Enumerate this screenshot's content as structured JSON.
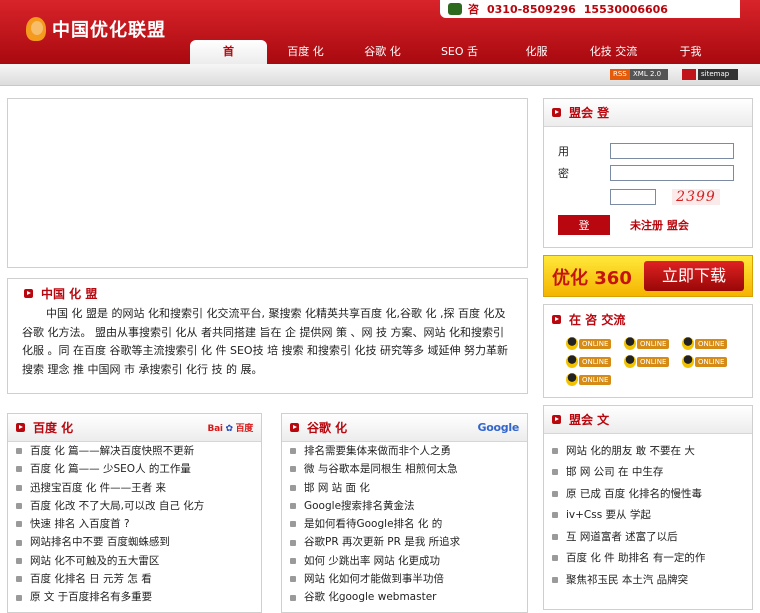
{
  "header": {
    "logo_text": "中国优化联盟",
    "phone_label": "咨",
    "phone1": "0310-8509296",
    "phone2": "15530006606"
  },
  "nav": [
    {
      "label": "首"
    },
    {
      "label": "百度 化"
    },
    {
      "label": "谷歌 化"
    },
    {
      "label": "SEO  舌"
    },
    {
      "label": "化服"
    },
    {
      "label": "化技 交流"
    },
    {
      "label": "于我"
    }
  ],
  "subbar": {
    "rss": "RSS",
    "xml": "XML 2.0",
    "sitemap": "sitemap"
  },
  "intro": {
    "title": "中国 化 盟",
    "text": "中国 化 盟是  的网站 化和搜索引  化交流平台, 聚搜索 化精英共享百度     化,谷歌 化  ,探 百度 化及谷歌 化方法。 盟由从事搜索引  化从 者共同搭建 旨在 企 提供网    策 、网    技 方案、网站 化和搜索引  化服 。同 在百度 谷歌等主流搜索引      化 件    SEO技 培  搜索    和搜索引  化技 研究等多 域延伸  努力革新搜索   理念 推 中国网    市     承搜索引  化行 技 的 展。"
  },
  "baidu": {
    "title": "百度 化",
    "logo_a": "Bai",
    "logo_b": "百度",
    "items": [
      "百度  化  篇——解决百度快照不更新",
      "百度  化  篇——  少SEO人 的工作量",
      "迅搜宝百度  化 件——王者  来",
      "百度  化改 不了大局,可以改 自己  化方",
      "快速      排名  入百度首 ?",
      "网站排名中不要  百度蜘蛛感到",
      "网站  化不可触及的五大雷区",
      "百度  化排名   日 元芳 怎  看",
      "原    文  于百度排名有多重要"
    ]
  },
  "google": {
    "title": "谷歌 化",
    "logo": "Google",
    "items": [
      "     排名需要集体来做而非个人之勇",
      "微  与谷歌本是同根生    相煎何太急",
      "邯    网   站    面   化",
      "Google搜索排名黄金法",
      "    是如何看待Google排名   化     的",
      "谷歌PR  再次更新 PR      是我   所追求",
      "如何   少跳出率  网站   化更成功",
      "网站  化如何才能做到事半功倍",
      "谷歌   化google webmaster"
    ]
  },
  "login": {
    "title": "盟会 登",
    "user_label": "用 名",
    "pass_label": "密",
    "captcha": "2399",
    "button": "登",
    "register": "未注册  盟会"
  },
  "ad": {
    "brand": "优化 360",
    "button": "立即下载"
  },
  "qq": {
    "title": "在 咨 交流",
    "tags": [
      "ONLINE",
      "ONLINE",
      "ONLINE",
      "ONLINE",
      "ONLINE",
      "ONLINE",
      "ONLINE"
    ]
  },
  "articles": {
    "title": "盟会  文",
    "items": [
      "网站  化的朋友  敢  不要在      大",
      "邯  网  公司  在      中生存",
      "原  已成  百度  化排名的慢性毒",
      "  iv+Css  要从    学起",
      "互  网道富者  述富了以后",
      "百度  化  件  助排名  有一定的作",
      "聚焦祁玉民  本土汽  品牌突"
    ]
  }
}
